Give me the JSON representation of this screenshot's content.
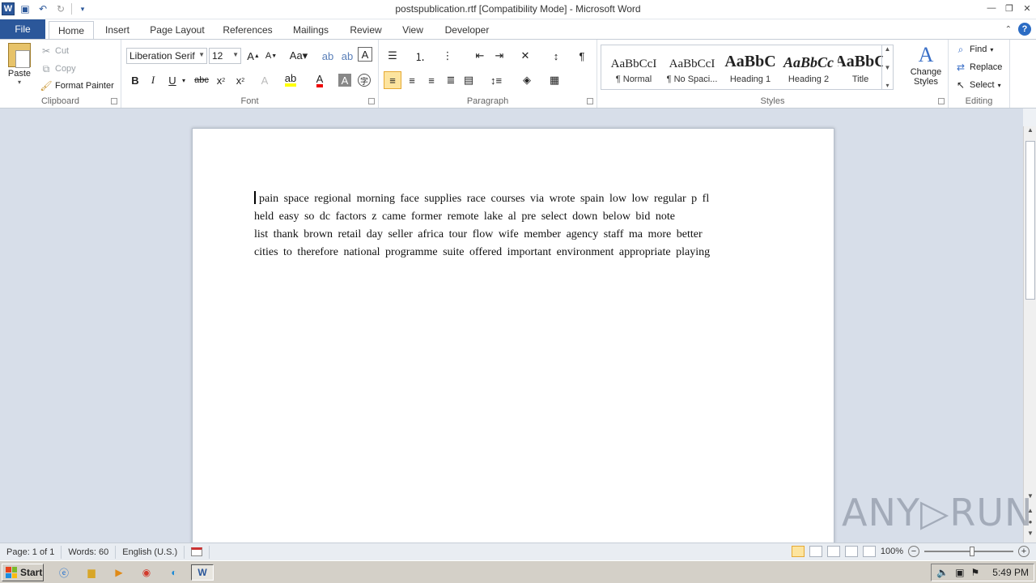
{
  "window": {
    "title": "postspublication.rtf [Compatibility Mode]  -  Microsoft Word",
    "app_icon": "W"
  },
  "tabs": [
    "File",
    "Home",
    "Insert",
    "Page Layout",
    "References",
    "Mailings",
    "Review",
    "View",
    "Developer"
  ],
  "clipboard": {
    "paste": "Paste",
    "cut": "Cut",
    "copy": "Copy",
    "format_painter": "Format Painter",
    "label": "Clipboard"
  },
  "font": {
    "name": "Liberation Serif",
    "size": "12",
    "label": "Font"
  },
  "paragraph": {
    "label": "Paragraph"
  },
  "styles": {
    "label": "Styles",
    "items": [
      {
        "preview": "AaBbCcI",
        "name": "¶ Normal"
      },
      {
        "preview": "AaBbCcI",
        "name": "¶ No Spaci..."
      },
      {
        "preview": "AaBbC",
        "name": "Heading 1"
      },
      {
        "preview": "AaBbCc",
        "name": "Heading 2"
      },
      {
        "preview": "AaBbC",
        "name": "Title"
      }
    ],
    "change_styles": "Change Styles"
  },
  "editing": {
    "label": "Editing",
    "find": "Find",
    "replace": "Replace",
    "select": "Select"
  },
  "document": {
    "lines": [
      "pain  space regional    morning  face    supplies  race courses via wrote  spain    low    low  regular  p fl",
      "held    easy     so dc factors  z came former    remote  lake    al pre select    down below       bid note",
      "list  thank  brown retail     day  seller  africa    tour  flow  wife  member     agency  staff ma    more better",
      "cities     to therefore  national  programme  suite  offered  important  environment  appropriate  playing"
    ]
  },
  "watermark": "ANY▷RUN",
  "status": {
    "page": "Page: 1 of 1",
    "words": "Words: 60",
    "language": "English (U.S.)",
    "zoom": "100%"
  },
  "taskbar": {
    "start": "Start",
    "clock": "5:49 PM"
  }
}
